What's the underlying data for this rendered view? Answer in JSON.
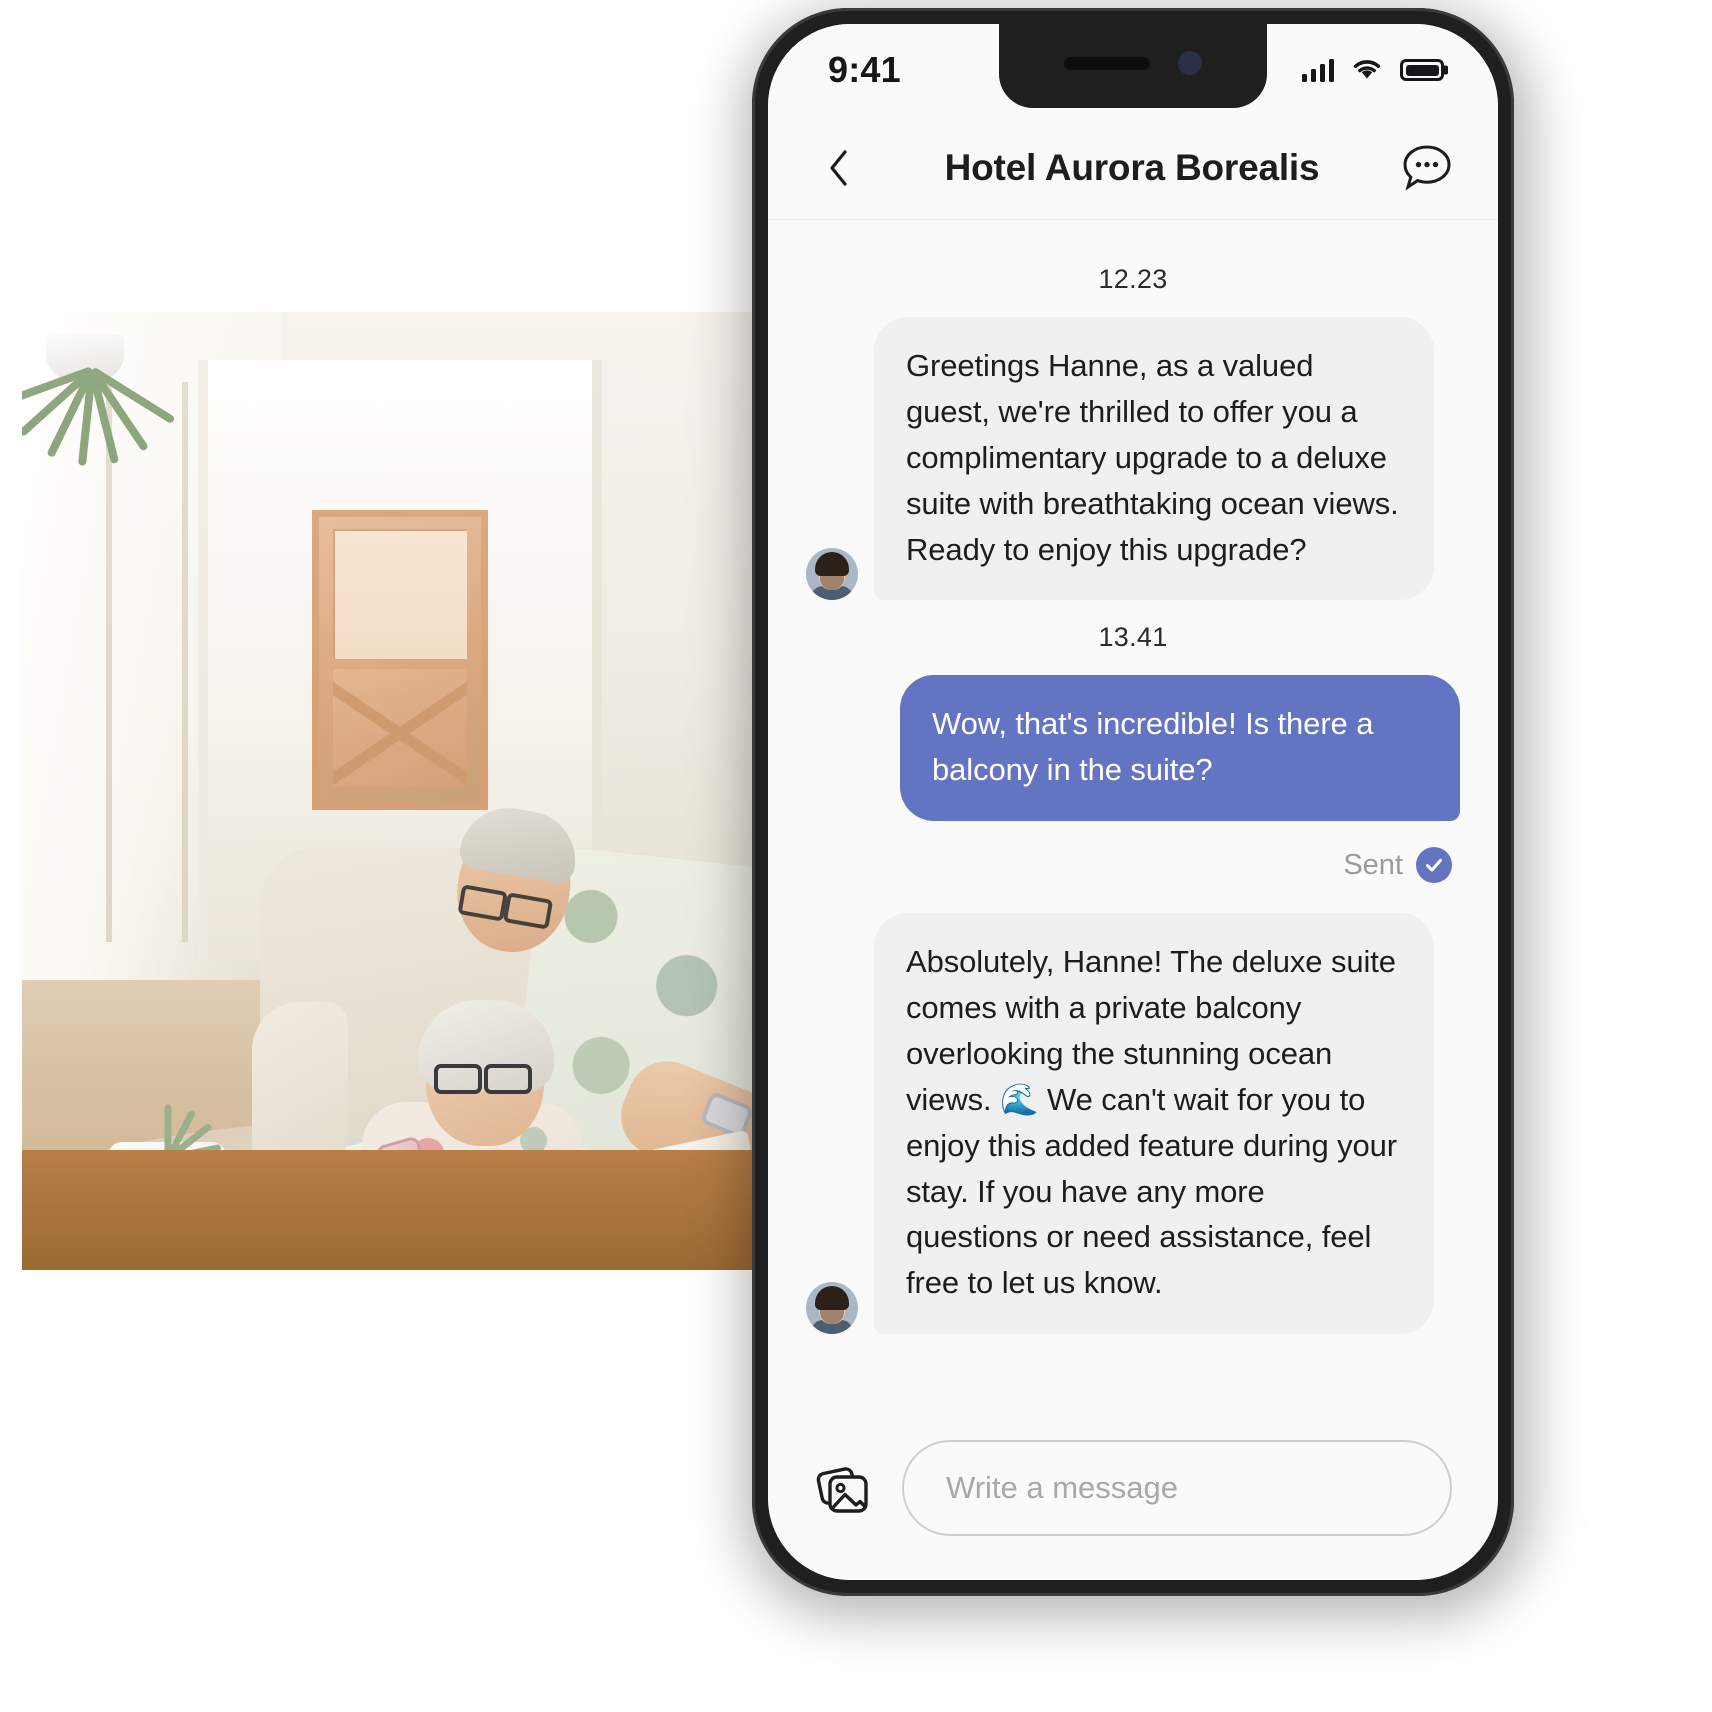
{
  "photo": {
    "alt": "elderly-couple-in-living-room-looking-at-smartphone"
  },
  "phone": {
    "status_bar": {
      "time": "9:41",
      "signal_icon": "cellular-signal-icon",
      "wifi_icon": "wifi-icon",
      "battery_icon": "battery-full-icon"
    },
    "header": {
      "back_icon": "chevron-left-icon",
      "title": "Hotel Aurora Borealis",
      "menu_icon": "chat-options-icon"
    },
    "conversation": [
      {
        "type": "timestamp",
        "time": "12.23"
      },
      {
        "type": "message",
        "direction": "incoming",
        "avatar": "agent-avatar",
        "text": "Greetings Hanne, as a valued guest, we're thrilled to offer you a complimentary upgrade to a deluxe suite with breathtaking ocean views. Ready to enjoy this upgrade?"
      },
      {
        "type": "timestamp",
        "time": "13.41"
      },
      {
        "type": "message",
        "direction": "outgoing",
        "text": "Wow, that's incredible! Is there a balcony in the suite?"
      },
      {
        "type": "status",
        "label": "Sent",
        "icon": "check-circle-icon"
      },
      {
        "type": "message",
        "direction": "incoming",
        "avatar": "agent-avatar",
        "text": "Absolutely, Hanne! The deluxe suite comes with a private balcony overlooking the stunning ocean views. 🌊 We can't wait for you to enjoy this added feature during your stay. If you have any more questions or need assistance, feel free to let us know."
      }
    ],
    "composer": {
      "gallery_icon": "image-gallery-icon",
      "input_value": "",
      "input_placeholder": "Write a message"
    },
    "colors": {
      "accent": "#6374c3",
      "incoming_bubble": "#f0f0f0",
      "screen_bg": "#fafafa",
      "frame": "#1f1f1f",
      "muted_text": "#9b9b9f"
    }
  }
}
